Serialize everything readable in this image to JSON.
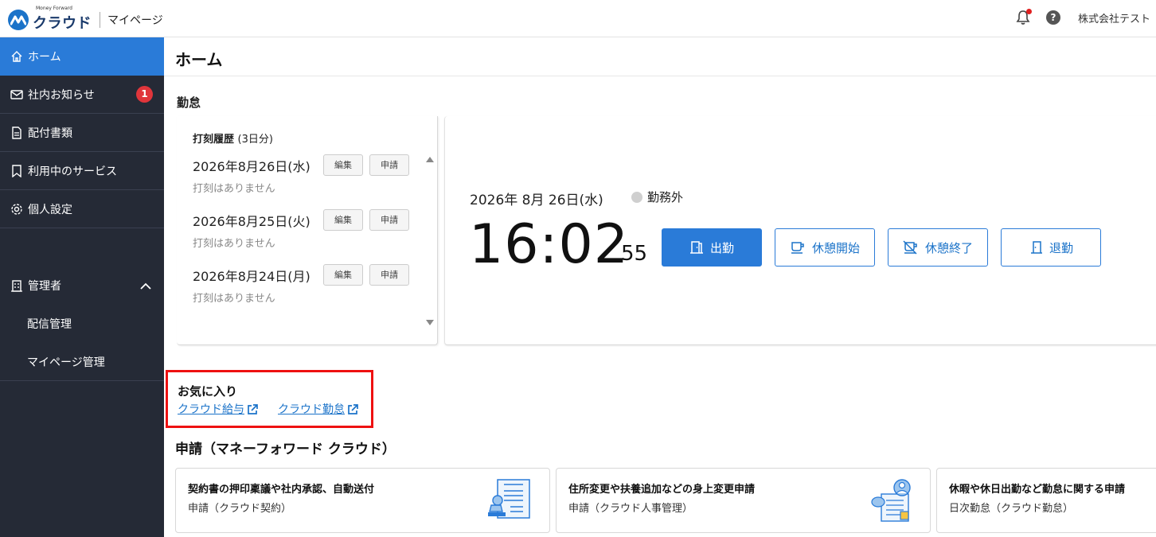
{
  "header": {
    "logo_small": "Money Forward",
    "logo_main": "クラウド",
    "logo_sub": "マイページ",
    "company": "株式会社テスト"
  },
  "sidebar": {
    "items": [
      {
        "label": "ホーム",
        "icon": "home-icon"
      },
      {
        "label": "社内お知らせ",
        "icon": "mail-icon",
        "badge": "1"
      },
      {
        "label": "配付書類",
        "icon": "document-icon"
      },
      {
        "label": "利用中のサービス",
        "icon": "bookmark-icon"
      },
      {
        "label": "個人設定",
        "icon": "gear-icon"
      }
    ],
    "admin": {
      "label": "管理者",
      "sub": [
        "配信管理",
        "マイページ管理"
      ]
    }
  },
  "main": {
    "title": "ホーム",
    "kintai_heading": "勤怠",
    "history": {
      "title": "打刻履歴",
      "title_suffix": "(3日分)",
      "edit_label": "編集",
      "request_label": "申請",
      "rows": [
        {
          "date": "2026年8月26日(水)",
          "note": "打刻はありません"
        },
        {
          "date": "2026年8月25日(火)",
          "note": "打刻はありません"
        },
        {
          "date": "2026年8月24日(月)",
          "note": "打刻はありません"
        }
      ]
    },
    "clock": {
      "date": "2026年 8月 26日(水)",
      "status": "勤務外",
      "time": "16:02",
      "seconds": "55",
      "buttons": [
        "出勤",
        "休憩開始",
        "休憩終了",
        "退勤"
      ]
    },
    "favorites": {
      "heading": "お気に入り",
      "links": [
        "クラウド給与",
        "クラウド勤怠"
      ]
    },
    "requests": {
      "heading": "申請（マネーフォワード クラウド）",
      "cards": [
        {
          "title": "契約書の押印稟議や社内承認、自動送付",
          "sub": "申請（クラウド契約）"
        },
        {
          "title": "住所変更や扶養追加などの身上変更申請",
          "sub": "申請（クラウド人事管理）"
        },
        {
          "title": "休暇や休日出勤など勤怠に関する申請",
          "sub": "日次勤怠（クラウド勤怠）"
        }
      ]
    }
  },
  "colors": {
    "accent": "#2a7bd8",
    "sidebar": "#252a36",
    "badge": "#e0353b",
    "highlight": "#ee1111"
  }
}
